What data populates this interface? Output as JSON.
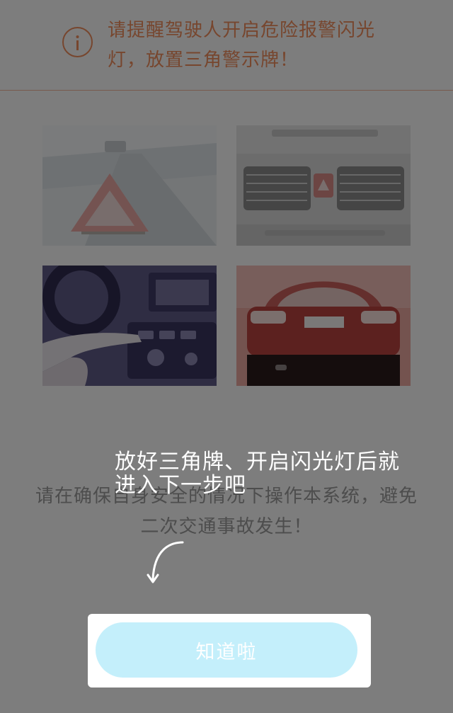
{
  "warning": {
    "icon": "info-icon",
    "text": "请提醒驾驶人开启危险报警闪光灯，放置三角警示牌！",
    "color": "#ef8d5c"
  },
  "photos": [
    {
      "name": "warning-triangle-photo"
    },
    {
      "name": "hazard-button-dashboard-photo"
    },
    {
      "name": "pressing-hazard-button-photo"
    },
    {
      "name": "car-flashing-lights-photo"
    }
  ],
  "safety_note": "请在确保自身安全的情况下操作本系统，避免二次交通事故发生！",
  "overlay": {
    "hint": "放好三角牌、开启闪光灯后就进入下一步吧",
    "arrow_icon": "curved-arrow-down-icon",
    "button_label": "知道啦",
    "button_color": "#c4effb"
  }
}
